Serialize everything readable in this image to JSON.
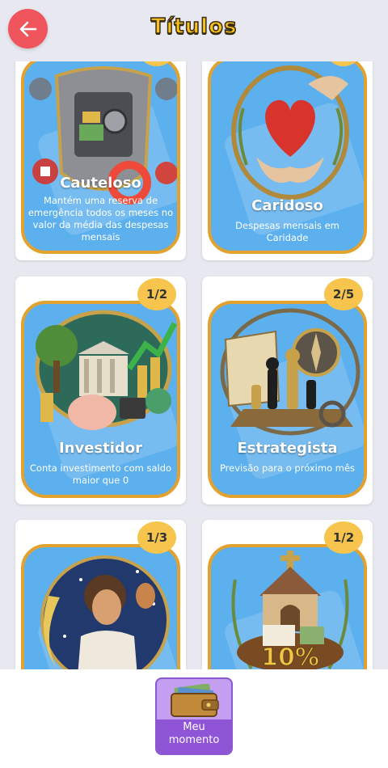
{
  "header": {
    "title": "Títulos",
    "back_icon": "arrow-left-icon",
    "back_color": "#f0545c"
  },
  "cards": [
    {
      "name": "Cauteloso",
      "description": "Mantém uma reserva de emergência todos os meses no valor da média das despesas mensais",
      "badge": "",
      "icon": "safe-shield-icon"
    },
    {
      "name": "Caridoso",
      "description": "Despesas mensais em Caridade",
      "badge": "",
      "icon": "heart-hands-icon"
    },
    {
      "name": "Investidor",
      "description": "Conta investimento com saldo maior que 0",
      "badge": "1/2",
      "icon": "piggy-bank-growth-icon"
    },
    {
      "name": "Estrategista",
      "description": "Previsão para o próximo mês",
      "badge": "2/5",
      "icon": "chess-map-compass-icon"
    },
    {
      "name": "",
      "description": "",
      "badge": "1/3",
      "icon": "dreamer-moon-icon"
    },
    {
      "name": "",
      "description": "",
      "badge": "1/2",
      "icon": "church-tithe-icon"
    }
  ],
  "bottom_nav": {
    "label": "Meu momento",
    "icon": "wallet-icon"
  },
  "colors": {
    "card_frame": "#e3a22e",
    "card_art_bg": "#5cb0ee",
    "badge": "#f7c54e",
    "bottom_button": "#8f55d6"
  }
}
